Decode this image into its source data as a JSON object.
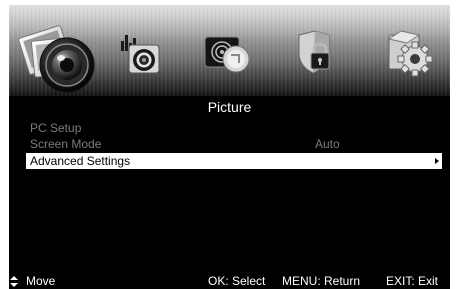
{
  "menu_tabs": [
    {
      "icon": "picture-camera-icon",
      "selected": true
    },
    {
      "icon": "sound-speaker-icon",
      "selected": false
    },
    {
      "icon": "channel-disc-icon",
      "selected": false
    },
    {
      "icon": "lock-shield-icon",
      "selected": false
    },
    {
      "icon": "setup-gear-icon",
      "selected": false
    }
  ],
  "page_title": "Picture",
  "items": [
    {
      "label": "PC Setup",
      "value": "",
      "state": "disabled"
    },
    {
      "label": "Screen Mode",
      "value": "Auto",
      "state": "disabled"
    },
    {
      "label": "Advanced Settings",
      "value": "",
      "state": "selected"
    }
  ],
  "footer": {
    "move": "Move",
    "select": "OK: Select",
    "return": "MENU: Return",
    "exit": "EXIT: Exit"
  },
  "colors": {
    "background": "#000000",
    "selected_row": "#ffffff",
    "disabled_text": "#7b7b7b",
    "text": "#ffffff"
  }
}
